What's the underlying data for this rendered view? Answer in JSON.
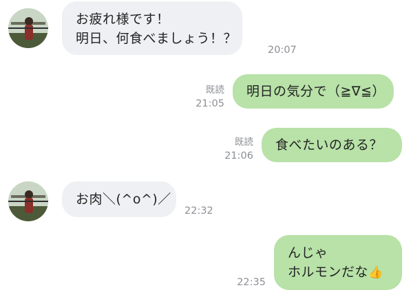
{
  "messages": [
    {
      "side": "in",
      "lines": [
        "お疲れ様です！",
        "明日、何食べましょう！？"
      ],
      "time": "20:07"
    },
    {
      "side": "out",
      "text": "明日の気分で（≧∇≦）",
      "read": "既読",
      "time": "21:05"
    },
    {
      "side": "out",
      "text": "食べたいのある？",
      "read": "既読",
      "time": "21:06"
    },
    {
      "side": "in",
      "text": "お肉＼(^o^)／",
      "time": "22:32"
    },
    {
      "side": "out",
      "lines": [
        "んじゃ",
        "ホルモンだな"
      ],
      "emoji": "👍",
      "time": "22:35"
    }
  ],
  "colors": {
    "incoming_bubble": "#eef0f3",
    "outgoing_bubble": "#b8e2a8",
    "meta_text": "#8c8f94"
  }
}
